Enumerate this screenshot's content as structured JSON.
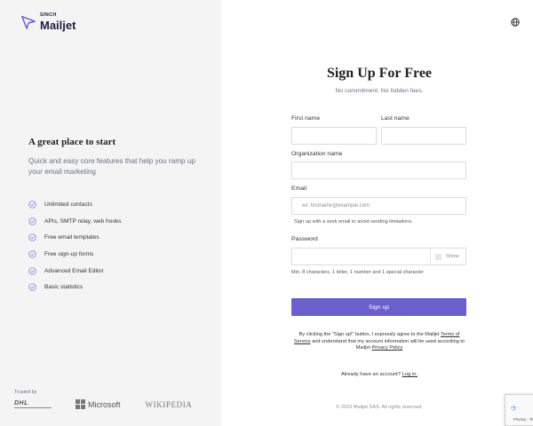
{
  "brand": {
    "top": "SINCH",
    "name": "Mailjet"
  },
  "left_panel": {
    "heading": "A great place to start",
    "subheading": "Quick and easy core features that help you ramp up your email marketing",
    "features": [
      "Unlimited contacts",
      "APIs, SMTP relay, web hooks",
      "Free email templates",
      "Free sign-up forms",
      "Advanced Email Editor",
      "Basic statistics"
    ],
    "trusted_label": "Trusted by",
    "trusted_brands": [
      "DHL",
      "Microsoft",
      "WIKIPEDIA"
    ]
  },
  "header": {
    "language_icon": "globe-icon"
  },
  "form": {
    "title": "Sign Up For Free",
    "tagline": "No commitment. No hidden fees.",
    "first_name_label": "First name",
    "first_name_value": "",
    "last_name_label": "Last name",
    "last_name_value": "",
    "org_label": "Organization name",
    "org_value": "",
    "email_label": "Email",
    "email_value": "",
    "email_placeholder": "ex: firstname@example.com",
    "email_hint": "Sign up with a work email to avoid sending limitations.",
    "password_label": "Password",
    "password_value": "",
    "show_label": "Show",
    "password_hint": "Min. 8 characters, 1 letter, 1 number and 1 special character",
    "submit_label": "Sign up",
    "legal_pre": "By clicking the \"Sign up!\" button, I expressly agree to the Mailjet ",
    "legal_terms": "Terms of Service",
    "legal_mid": " and understand that my account information will be used according to Mailjet ",
    "legal_privacy": "Privacy Policy",
    "have_account": "Already have an account? ",
    "login_link": "Log in.",
    "copyright": "© 2023 Mailjet SAS. All rights reserved."
  },
  "recaptcha": {
    "text": "Privacy - Terms"
  },
  "colors": {
    "accent": "#6b5fce",
    "left_bg": "#f4f4f4",
    "check": "#8b80d6"
  }
}
